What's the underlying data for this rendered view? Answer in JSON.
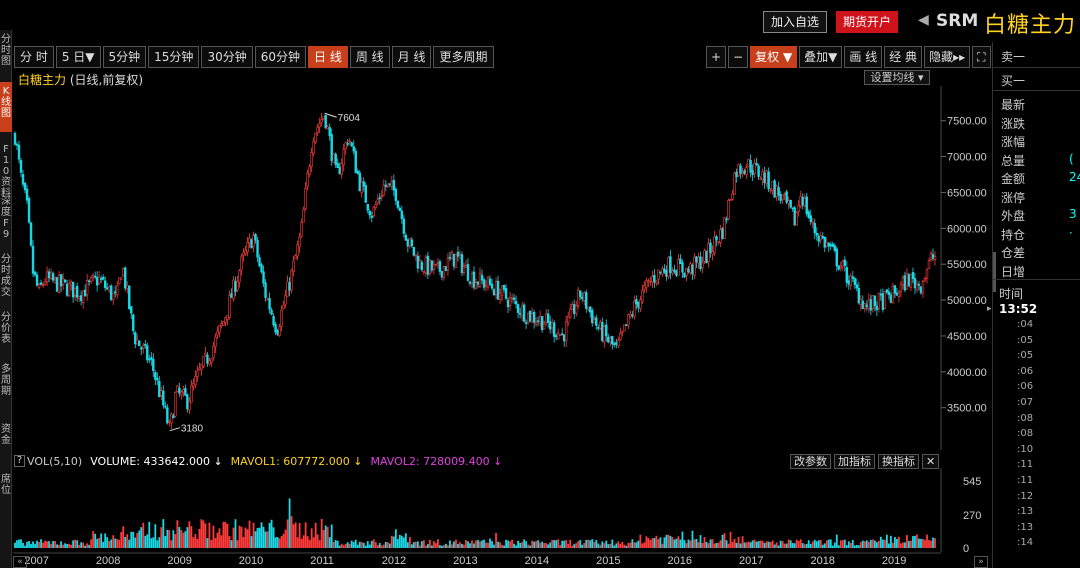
{
  "header": {
    "add_watch": "加入自选",
    "open_account": "期货开户",
    "arrow": "◀",
    "symbol": "SRM",
    "name": "白糖主力"
  },
  "left_tabs": [
    {
      "label": "分时图",
      "active": false
    },
    {
      "label": "K线图",
      "active": true
    },
    {
      "label": "F10资料",
      "active": false
    },
    {
      "label": "深度F9",
      "active": false
    },
    {
      "label": "分时成交",
      "active": false
    },
    {
      "label": "分价表",
      "active": false
    },
    {
      "label": "多周期",
      "active": false
    },
    {
      "label": "资金",
      "active": false
    },
    {
      "label": "席位",
      "active": false
    }
  ],
  "toolbar": {
    "periods": [
      {
        "label": "分 时",
        "active": false
      },
      {
        "label": "5 日▼",
        "active": false
      },
      {
        "label": "5分钟",
        "active": false
      },
      {
        "label": "15分钟",
        "active": false
      },
      {
        "label": "30分钟",
        "active": false
      },
      {
        "label": "60分钟",
        "active": false
      },
      {
        "label": "日 线",
        "active": true
      },
      {
        "label": "周 线",
        "active": false
      },
      {
        "label": "月 线",
        "active": false
      },
      {
        "label": "更多周期",
        "active": false
      }
    ],
    "right": [
      {
        "label": "+",
        "active": false
      },
      {
        "label": "−",
        "active": false
      },
      {
        "label": "复权 ▼",
        "active": true
      },
      {
        "label": "叠加▼",
        "active": false
      },
      {
        "label": "画 线",
        "active": false
      },
      {
        "label": "经 典",
        "active": false
      },
      {
        "label": "隐藏▸▸",
        "active": false
      },
      {
        "label": "⛶",
        "active": false
      }
    ]
  },
  "chart": {
    "title": "白糖主力",
    "subtitle": "(日线,前复权)",
    "ma_button": "设置均线 ▾",
    "high_label": "7604",
    "low_label": "3180"
  },
  "chart_data": {
    "type": "candlestick",
    "title": "白糖主力",
    "subtitle": "(日线,前复权)",
    "y_ticks": [
      3500,
      4000,
      4500,
      5000,
      5500,
      6000,
      6500,
      7000,
      7500
    ],
    "y_tick_labels": [
      "3500.00",
      "4000.00",
      "4500.00",
      "5000.00",
      "5500.00",
      "6000.00",
      "6500.00",
      "7000.00",
      "7500.00"
    ],
    "ylim": [
      3050,
      7900
    ],
    "x_years": [
      "2007",
      "2008",
      "2009",
      "2010",
      "2011",
      "2012",
      "2013",
      "2014",
      "2015",
      "2016",
      "2017",
      "2018",
      "2019"
    ],
    "price_path": [
      [
        "2006-10",
        7300
      ],
      [
        "2006-11",
        6700
      ],
      [
        "2006-12",
        6300
      ],
      [
        "2007-01",
        5400
      ],
      [
        "2007-02",
        5100
      ],
      [
        "2007-03",
        5300
      ],
      [
        "2007-06",
        5200
      ],
      [
        "2007-09",
        5100
      ],
      [
        "2007-12",
        5300
      ],
      [
        "2008-03",
        5000
      ],
      [
        "2008-04",
        5500
      ],
      [
        "2008-06",
        4500
      ],
      [
        "2008-09",
        4100
      ],
      [
        "2008-11",
        3500
      ],
      [
        "2008-12",
        3180
      ],
      [
        "2009-01",
        3700
      ],
      [
        "2009-03",
        3600
      ],
      [
        "2009-05",
        4000
      ],
      [
        "2009-07",
        4300
      ],
      [
        "2009-09",
        4700
      ],
      [
        "2009-12",
        5500
      ],
      [
        "2010-02",
        5900
      ],
      [
        "2010-04",
        5100
      ],
      [
        "2010-06",
        4600
      ],
      [
        "2010-08",
        5200
      ],
      [
        "2010-10",
        5900
      ],
      [
        "2010-12",
        7300
      ],
      [
        "2011-02",
        7604
      ],
      [
        "2011-04",
        6700
      ],
      [
        "2011-06",
        7300
      ],
      [
        "2011-08",
        6600
      ],
      [
        "2011-10",
        6200
      ],
      [
        "2011-12",
        6600
      ],
      [
        "2012-02",
        6500
      ],
      [
        "2012-04",
        5800
      ],
      [
        "2012-06",
        5500
      ],
      [
        "2012-09",
        5400
      ],
      [
        "2012-12",
        5600
      ],
      [
        "2013-03",
        5300
      ],
      [
        "2013-06",
        5200
      ],
      [
        "2013-09",
        5000
      ],
      [
        "2013-12",
        4800
      ],
      [
        "2014-03",
        4700
      ],
      [
        "2014-06",
        4500
      ],
      [
        "2014-09",
        5100
      ],
      [
        "2014-12",
        4600
      ],
      [
        "2015-03",
        4300
      ],
      [
        "2015-06",
        4900
      ],
      [
        "2015-09",
        5300
      ],
      [
        "2015-12",
        5500
      ],
      [
        "2016-03",
        5400
      ],
      [
        "2016-06",
        5600
      ],
      [
        "2016-09",
        6000
      ],
      [
        "2016-11",
        6800
      ],
      [
        "2017-01",
        6900
      ],
      [
        "2017-04",
        6700
      ],
      [
        "2017-07",
        6400
      ],
      [
        "2017-09",
        6100
      ],
      [
        "2017-10",
        6500
      ],
      [
        "2017-12",
        6000
      ],
      [
        "2018-03",
        5700
      ],
      [
        "2018-06",
        5300
      ],
      [
        "2018-09",
        4900
      ],
      [
        "2018-12",
        5000
      ],
      [
        "2019-02",
        5100
      ],
      [
        "2019-04",
        5300
      ],
      [
        "2019-06",
        5200
      ],
      [
        "2019-08",
        5600
      ]
    ],
    "volume": {
      "label": "VOL(5,10)",
      "value_label": "VOLUME: 433642.000",
      "mavol1_label": "MAVOL1: 607772.000",
      "mavol2_label": "MAVOL2: 728009.400",
      "y_ticks": [
        0,
        270,
        545
      ],
      "ylim": [
        0,
        620
      ]
    }
  },
  "volume_header": {
    "q": "?",
    "label": "VOL(5,10)",
    "volume": "VOLUME: 433642.000 ↓",
    "mavol1": "MAVOL1: 607772.000 ↓",
    "mavol2": "MAVOL2: 728009.400 ↓",
    "buttons": [
      "改参数",
      "加指标",
      "换指标",
      "✕"
    ]
  },
  "scroll": {
    "left": "«",
    "right": "»"
  },
  "right_panel": {
    "sell1": "卖一",
    "buy1": "买一",
    "rows": [
      {
        "label": "最新",
        "value": ""
      },
      {
        "label": "涨跌",
        "value": ""
      },
      {
        "label": "涨幅",
        "value": ""
      },
      {
        "label": "总量",
        "value": "("
      },
      {
        "label": "金额",
        "value": "24"
      },
      {
        "label": "涨停",
        "value": ""
      },
      {
        "label": "外盘",
        "value": "3"
      },
      {
        "label": "持仓",
        "value": "·"
      },
      {
        "label": "仓差",
        "value": ""
      },
      {
        "label": "日增",
        "value": ""
      }
    ],
    "time_label": "时间",
    "time": "13:52",
    "ticks": [
      ":04",
      ":05",
      ":05",
      ":06",
      ":06",
      ":07",
      ":08",
      ":08",
      ":10",
      ":11",
      ":11",
      ":12",
      ":13",
      ":13",
      ":14"
    ]
  },
  "colors": {
    "up": "#ff3b3b",
    "down": "#19d9e6",
    "accent": "#c8401b",
    "title": "#ffd21f",
    "mavol2": "#e040e0"
  }
}
